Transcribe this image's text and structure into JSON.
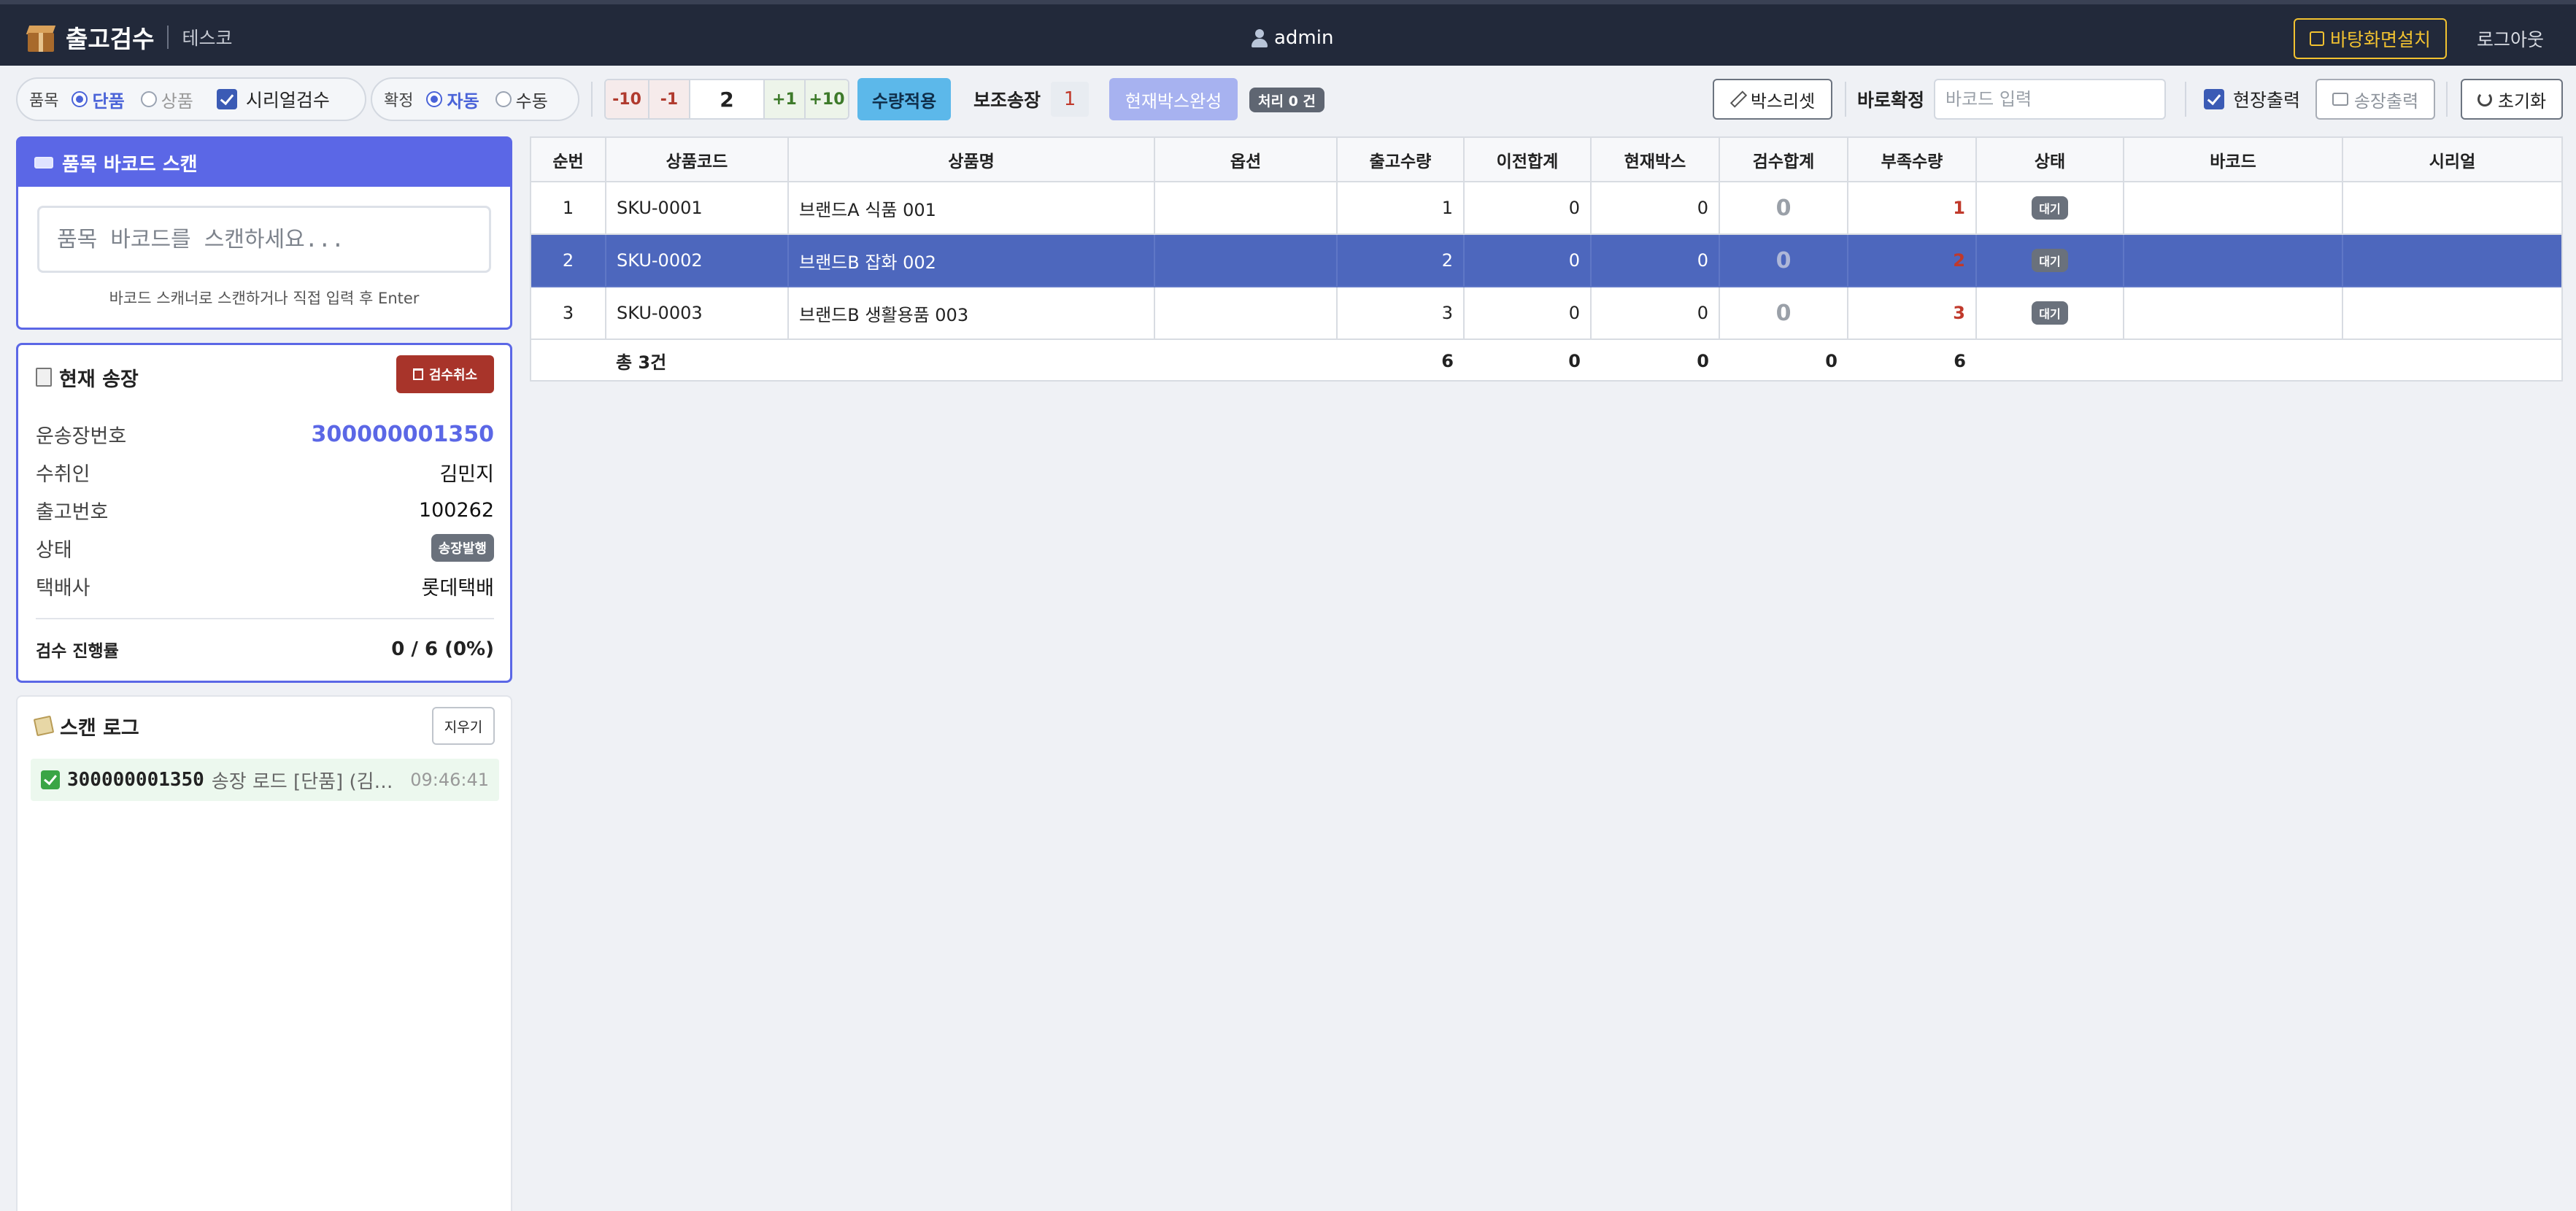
{
  "header": {
    "title": "출고검수",
    "subtitle": "테스코",
    "user": "admin",
    "wallpaper_button": "바탕화면설치",
    "logout": "로그아웃"
  },
  "toolbar": {
    "item_label": "품목",
    "item_options": [
      "단품",
      "상품"
    ],
    "item_selected": "단품",
    "serial_check": "시리얼검수",
    "confirm_label": "확정",
    "confirm_options": [
      "자동",
      "수동"
    ],
    "confirm_selected": "자동",
    "steps_neg": [
      "-10",
      "-1"
    ],
    "quantity": "2",
    "steps_pos": [
      "+1",
      "+10"
    ],
    "apply": "수량적용",
    "aux_invoice_label": "보조송장",
    "aux_invoice_value": "1",
    "box_complete": "현재박스완성",
    "processed_badge": "처리 0 건",
    "box_reset": "박스리셋",
    "direct_confirm_label": "바로확정",
    "barcode_placeholder": "바코드 입력",
    "site_print": "현장출력",
    "invoice_print": "송장출력",
    "reset": "초기화"
  },
  "scan": {
    "title": "품목 바코드 스캔",
    "placeholder": "품목 바코드를 스캔하세요...",
    "hint": "바코드 스캐너로 스캔하거나 직접 입력 후 Enter"
  },
  "invoice": {
    "title": "현재 송장",
    "cancel": "검수취소",
    "rows": [
      {
        "label": "운송장번호",
        "value": "300000001350"
      },
      {
        "label": "수취인",
        "value": "김민지"
      },
      {
        "label": "출고번호",
        "value": "100262"
      },
      {
        "label": "상태",
        "value": "송장발행"
      },
      {
        "label": "택배사",
        "value": "롯데택배"
      }
    ],
    "progress_label": "검수 진행률",
    "progress_value": "0 / 6 (0%)"
  },
  "log": {
    "title": "스캔 로그",
    "clear": "지우기",
    "items": [
      {
        "code": "300000001350",
        "message": "송장 로드 [단품] (김민지, ...",
        "time": "09:46:41"
      }
    ]
  },
  "table": {
    "columns": [
      "순번",
      "상품코드",
      "상품명",
      "옵션",
      "출고수량",
      "이전합계",
      "현재박스",
      "검수합계",
      "부족수량",
      "상태",
      "바코드",
      "시리얼"
    ],
    "rows": [
      {
        "no": "1",
        "code": "SKU-0001",
        "name": "브랜드A 식품 001",
        "option": "",
        "qty": "1",
        "prev": "0",
        "box": "0",
        "checked": "0",
        "short": "1",
        "status": "대기",
        "barcode": "",
        "serial": ""
      },
      {
        "no": "2",
        "code": "SKU-0002",
        "name": "브랜드B 잡화 002",
        "option": "",
        "qty": "2",
        "prev": "0",
        "box": "0",
        "checked": "0",
        "short": "2",
        "status": "대기",
        "barcode": "",
        "serial": ""
      },
      {
        "no": "3",
        "code": "SKU-0003",
        "name": "브랜드B 생활용품 003",
        "option": "",
        "qty": "3",
        "prev": "0",
        "box": "0",
        "checked": "0",
        "short": "3",
        "status": "대기",
        "barcode": "",
        "serial": ""
      }
    ],
    "selected_row": 2,
    "total": {
      "label": "총 3건",
      "qty": "6",
      "prev": "0",
      "box": "0",
      "checked": "0",
      "short": "6"
    }
  },
  "colors": {
    "accent": "#5b67e6",
    "header_bg": "#22293a",
    "selected_row": "#4d67bd",
    "danger": "#a8342a",
    "warning": "#f2c230"
  }
}
